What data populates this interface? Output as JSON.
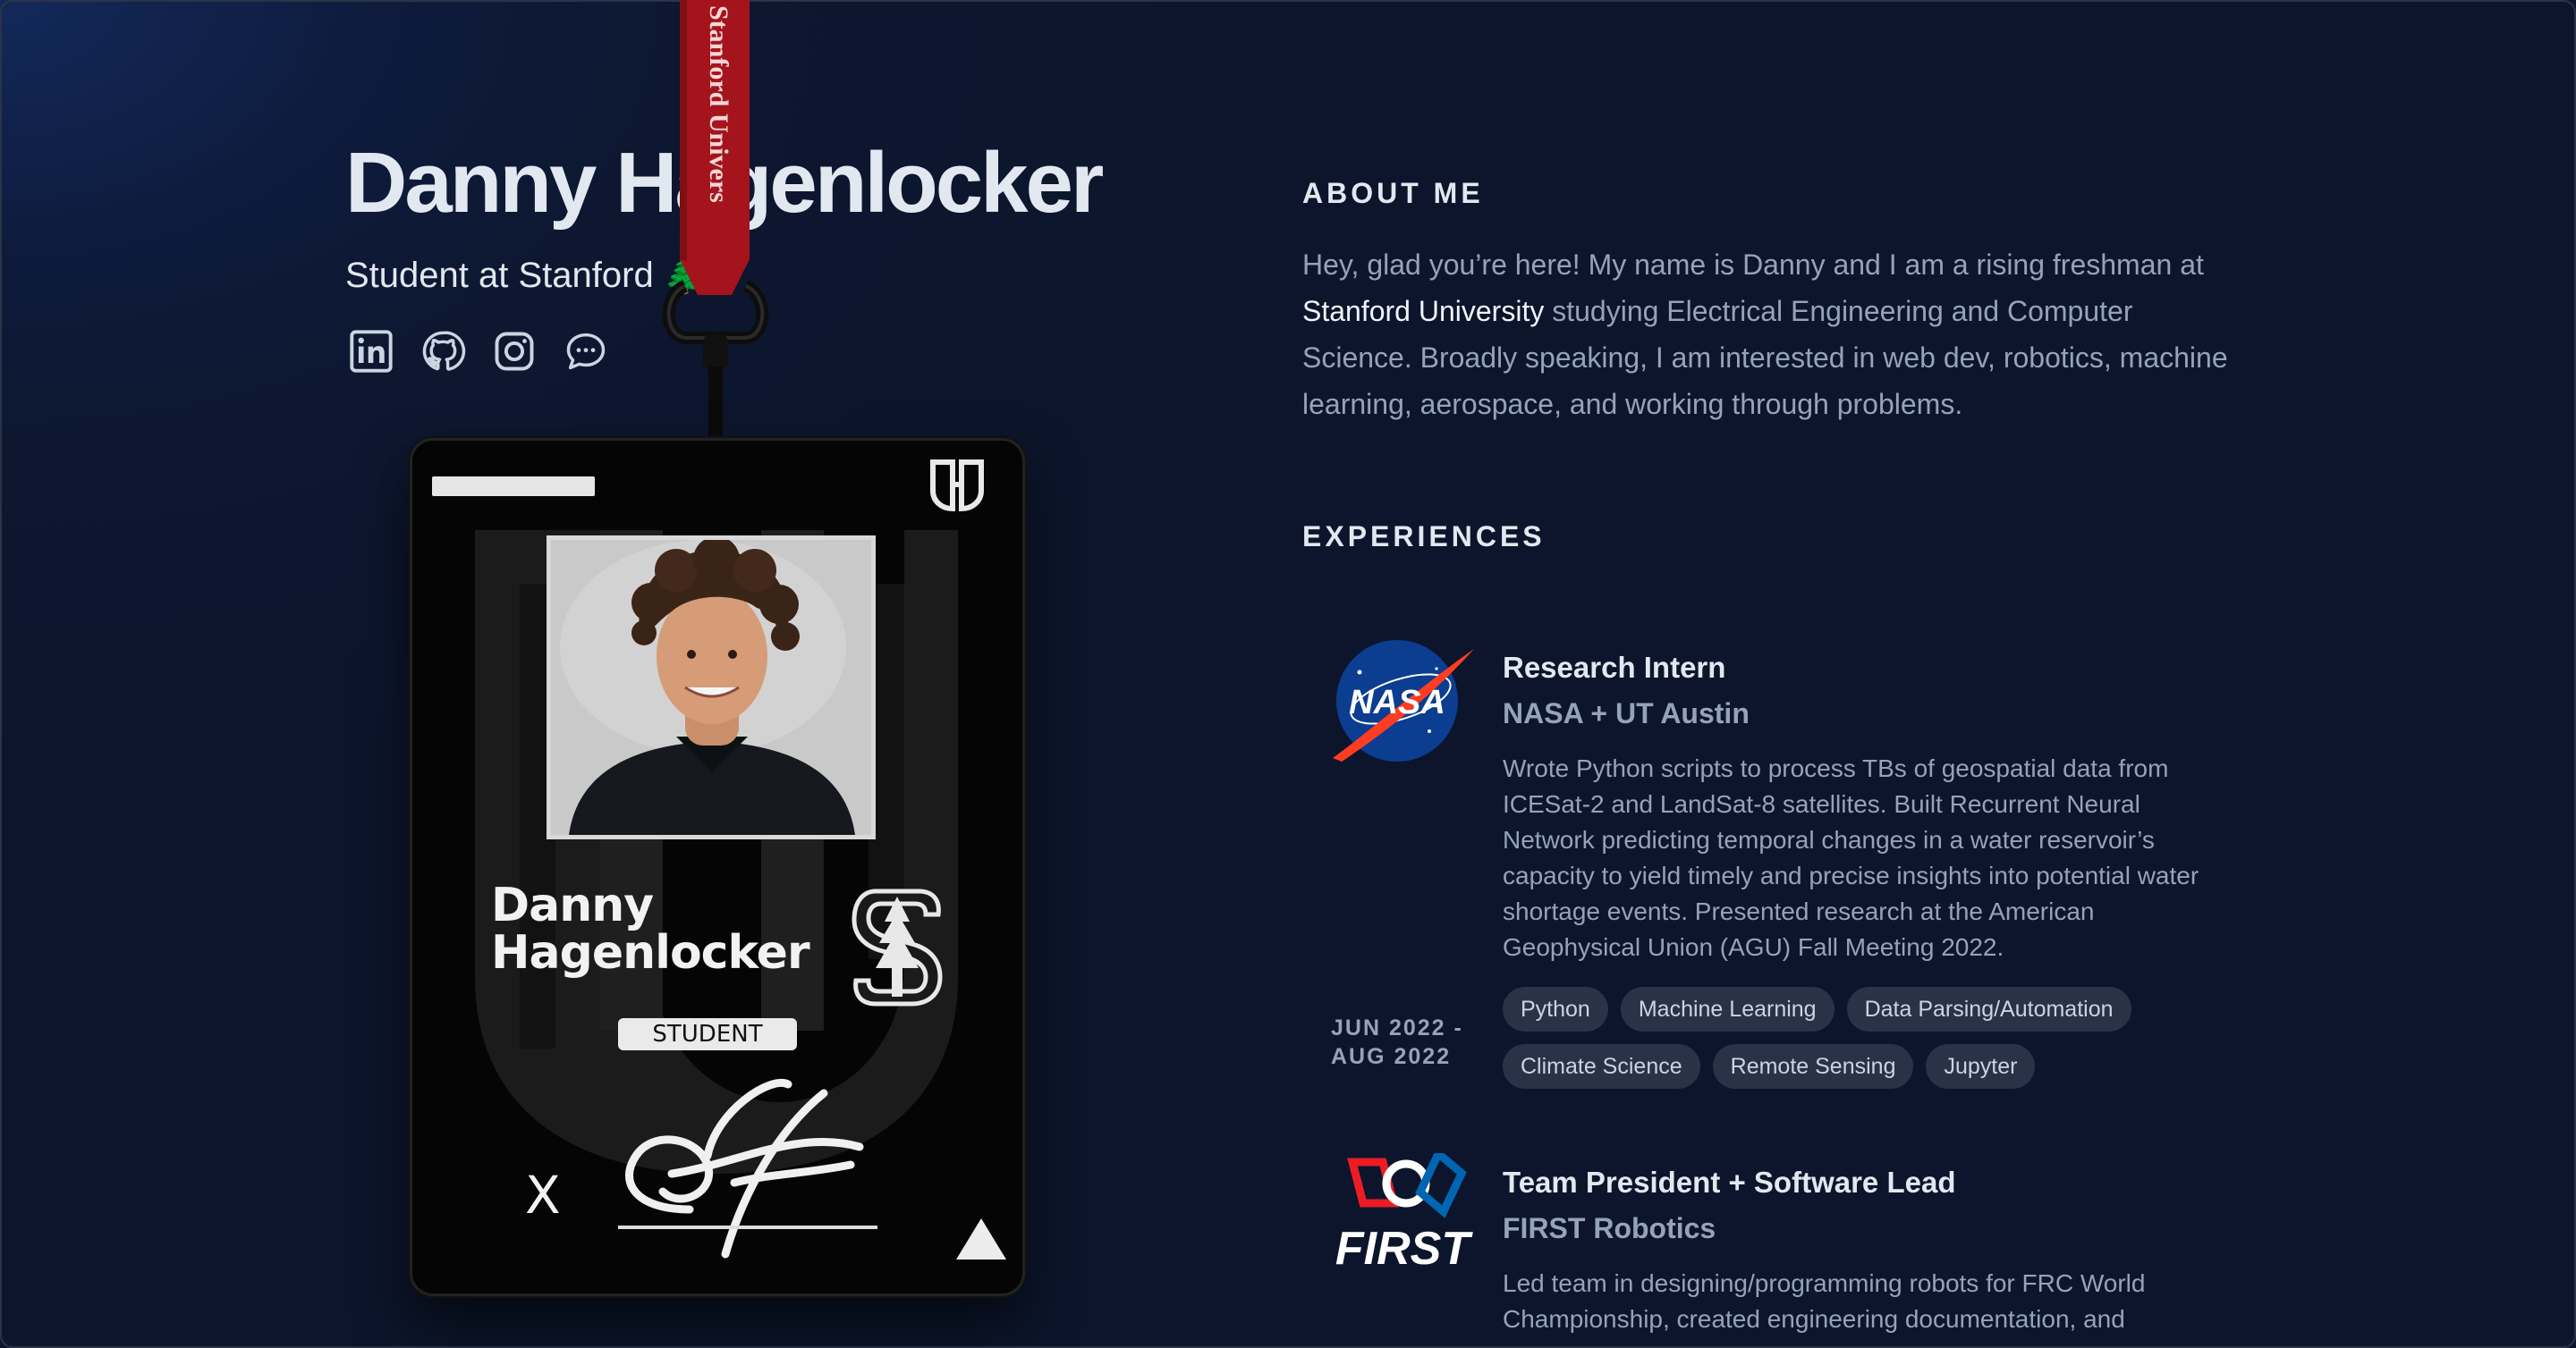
{
  "header": {
    "name": "Danny Hagenlocker",
    "subtitle": "Student at Stanford",
    "subtitle_emoji": "🌲",
    "caret": "|",
    "socials": [
      {
        "icon": "linkedin-icon"
      },
      {
        "icon": "github-icon"
      },
      {
        "icon": "instagram-icon"
      },
      {
        "icon": "message-icon"
      }
    ]
  },
  "badge": {
    "lanyard_text": "Stanford University",
    "first_name": "Danny",
    "last_name": "Hagenlocker",
    "role": "STUDENT",
    "signature_mark": "X",
    "logo": "DH"
  },
  "about": {
    "title": "ABOUT ME",
    "text_before": "Hey, glad you’re here! My name is Danny and I am a rising freshman at ",
    "highlight": "Stanford University",
    "text_after": " studying Electrical Engineering and Computer Science. Broadly speaking, I am interested in web dev, robotics, machine learning, aerospace, and working through problems."
  },
  "experiences": {
    "title": "EXPERIENCES",
    "items": [
      {
        "logo_text": "NASA",
        "date_line1": "JUN 2022 -",
        "date_line2": "AUG 2022",
        "title": "Research Intern",
        "org": "NASA + UT Austin",
        "description": "Wrote Python scripts to process TBs of geospatial data from ICESat-2 and LandSat-8 satellites. Built Recurrent Neural Network predicting temporal changes in a water reservoir’s capacity to yield timely and precise insights into potential water shortage events. Presented research at the American Geophysical Union (AGU) Fall Meeting 2022.",
        "tags": [
          "Python",
          "Machine Learning",
          "Data Parsing/Automation",
          "Climate Science",
          "Remote Sensing",
          "Jupyter"
        ]
      },
      {
        "logo_text": "FIRST",
        "title": "Team President + Software Lead",
        "org": "FIRST Robotics",
        "description": "Led team in designing/programming robots for FRC World Championship, created engineering documentation, and"
      }
    ]
  },
  "colors": {
    "background": "#0c152b",
    "accent_text": "#e2e8f0",
    "muted_text": "#94a3b8",
    "tag_bg": "#293347",
    "lanyard": "#a5141c"
  }
}
